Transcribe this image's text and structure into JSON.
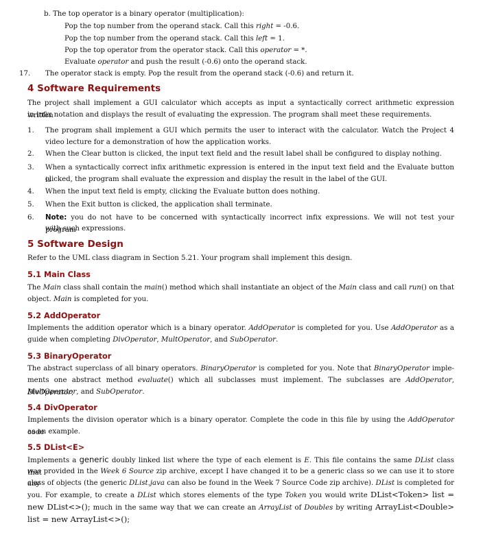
{
  "algorithm_tail": {
    "step_b": "b. The top operator is a binary operator (multiplication):",
    "lines": [
      {
        "pre": "Pop the top number from the operand stack. Call this ",
        "em": "right",
        "post": " = -0.6."
      },
      {
        "pre": "Pop the top number from the operand stack. Call this ",
        "em": "left",
        "post": " = 1."
      },
      {
        "pre": "Pop the top operator from the operator stack. Call this ",
        "em": "operator",
        "post": " = *."
      },
      {
        "pre": "Evaluate ",
        "em": "operator",
        "post": " and push the result (-0.6) onto the operand stack."
      }
    ],
    "step17_num": "17.",
    "step17_text": "The operator stack is empty. Pop the result from the operand stack (-0.6) and return it."
  },
  "section4": {
    "heading": "4  Software Requirements",
    "intro_l1": "The project shall implement a GUI calculator which accepts as input a syntactically correct arithmetic expression written",
    "intro_l2": "in infix notation and displays the result of evaluating the expression. The program shall meet these requirements.",
    "requirements": [
      {
        "num": "1.",
        "l1": "The program shall implement a GUI which permits the user to interact with the calculator. Watch the Project 4",
        "l2": "video lecture for a demonstration of how the application works."
      },
      {
        "num": "2.",
        "l1": "When the Clear button is clicked, the input text field and the result label shall be configured to display nothing.",
        "l2": ""
      },
      {
        "num": "3.",
        "l1": "When a syntactically correct infix arithmetic expression is entered in the input text field and the Evaluate button is",
        "l2": "clicked, the program shall evaluate the expression and display the result in the label of the GUI."
      },
      {
        "num": "4.",
        "l1": "When the input text field is empty, clicking the Evaluate button does nothing.",
        "l2": ""
      },
      {
        "num": "5.",
        "l1": "When the Exit button is clicked, the application shall terminate.",
        "l2": ""
      },
      {
        "num": "6.",
        "note_label": "Note:",
        "l1": " you do not have to be concerned with syntactically incorrect infix expressions. We will not test your program",
        "l2": "with such expressions."
      }
    ]
  },
  "section5": {
    "heading": "5  Software Design",
    "intro": "Refer to the UML class diagram in Section 5.21. Your program shall implement this design.",
    "s51": {
      "heading": "5.1  Main Class",
      "t1": "The ",
      "e1": "Main",
      "t2": " class shall contain the ",
      "e2": "main",
      "t3": "() method which shall instantiate an object of the ",
      "e3": "Main",
      "t4": " class and call ",
      "e4": "run",
      "t5": "() on that",
      "l2_e": "object. ",
      "l2_em": "Main",
      "l2_post": " is completed for you."
    },
    "s52": {
      "heading": "5.2  AddOperator",
      "t1": "Implements the addition operator which is a binary operator. ",
      "e1": "AddOperator",
      "t2": " is completed for you. Use ",
      "e2": "AddOperator",
      "t3": " as a",
      "l2_t1": "guide when completing ",
      "l2_e1": "DivOperator",
      "l2_t2": ", ",
      "l2_e2": "MultOperator",
      "l2_t3": ", and ",
      "l2_e3": "SubOperator",
      "l2_t4": "."
    },
    "s53": {
      "heading": "5.3  BinaryOperator",
      "t1": "The abstract superclass of all binary operators. ",
      "e1": "BinaryOperator",
      "t2": " is completed for you. Note that ",
      "e2": "BinaryOperator",
      "t3": " imple-",
      "l2_t1": "ments one abstract method ",
      "l2_e1": "evaluate",
      "l2_t2": "() which all subclasses must implement. The subclasses are ",
      "l2_e2": "AddOperator",
      "l2_t3": ", ",
      "l2_e3": "DivOperator",
      "l2_t4": ",",
      "l3_e1": "MultOperator",
      "l3_t1": ", and ",
      "l3_e2": "SubOperator",
      "l3_t2": "."
    },
    "s54": {
      "heading": "5.4  DivOperator",
      "t1": "Implements the division operator which is a binary operator. Complete the code in this file by using the ",
      "e1": "AddOperator",
      "t2": " code",
      "l2": "as an example."
    },
    "s55": {
      "heading": "5.5  DList<E>",
      "l1_t1": "Implements a ",
      "l1_g": "generic",
      "l1_t2": " doubly linked list where the type of each element is ",
      "l1_e1": "E",
      "l1_t3": ". This file contains the same ",
      "l1_e2": "DList",
      "l1_t4": " class that",
      "l2_t1": "was provided in the ",
      "l2_e1": "Week 6 Source",
      "l2_t2": " zip archive, except I have changed it to be a generic class so we can use it to store any",
      "l3_t1": "class of objects (the generic ",
      "l3_e1": "DList.java",
      "l3_t2": " can also be found in the Week 7 Source Code zip archive). ",
      "l3_e2": "DList",
      "l3_t3": " is completed for",
      "l4_t1": "you. For example, to create a ",
      "l4_e1": "DList",
      "l4_t2": " which stores elements of the type ",
      "l4_e2": "Token",
      "l4_t3": " you would write ",
      "l4_c": "DList<Token> list =",
      "l5_c1": "new DList<>();",
      "l5_t1": " much in the same way that we can create an ",
      "l5_e1": "ArrayList",
      "l5_t2": " of ",
      "l5_e2": "Doubles",
      "l5_t3": " by writing ",
      "l5_c2": "ArrayList<Double>",
      "l6_c": "list = new ArrayList<>();"
    }
  }
}
